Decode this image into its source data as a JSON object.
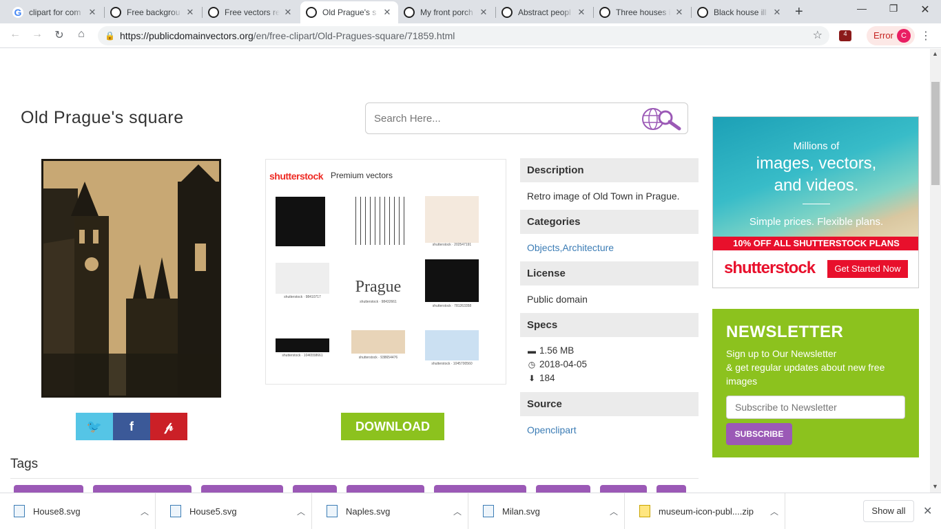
{
  "browser": {
    "tabs": [
      {
        "title": "clipart for com",
        "favicon": "google-icon"
      },
      {
        "title": "Free backgrou",
        "favicon": "site-icon"
      },
      {
        "title": "Free vectors re",
        "favicon": "site-icon"
      },
      {
        "title": "Old Prague's s",
        "favicon": "site-icon",
        "active": true
      },
      {
        "title": "My front porch",
        "favicon": "site-icon"
      },
      {
        "title": "Abstract peopl",
        "favicon": "site-icon"
      },
      {
        "title": "Three houses i",
        "favicon": "site-icon"
      },
      {
        "title": "Black house ill",
        "favicon": "site-icon"
      }
    ],
    "url_domain": "https://publicdomainvectors.org",
    "url_path": "/en/free-clipart/Old-Pragues-square/71859.html",
    "extension_badge": "4",
    "error_label": "Error",
    "avatar_letter": "C"
  },
  "page": {
    "title": "Old Prague's square",
    "search_placeholder": "Search Here...",
    "download_label": "DOWNLOAD",
    "ad": {
      "brand": "shutterstock",
      "subtitle": "Premium vectors",
      "captions": [
        "shutterstock · 202547191",
        "shutterstock · 98410717",
        "Prague",
        "shutterstock · 98432661",
        "shutterstock · 781263358",
        "shutterstock · 1046558661",
        "shutterstock · 938654476",
        "shutterstock · 1045700560"
      ]
    },
    "info": {
      "description_header": "Description",
      "description": "Retro image of Old Town in Prague.",
      "categories_header": "Categories",
      "categories": "Objects,Architecture",
      "license_header": "License",
      "license": "Public domain",
      "specs_header": "Specs",
      "size": "1.56 MB",
      "date": "2018-04-05",
      "downloads": "184",
      "source_header": "Source",
      "source": "Openclipart"
    },
    "tags_header": "Tags"
  },
  "side_ad": {
    "line1": "Millions of",
    "line2": "images, vectors,",
    "line3": "and videos.",
    "line4": "Simple prices. Flexible plans.",
    "banner": "10% OFF ALL SHUTTERSTOCK PLANS",
    "logo": "shutterstock",
    "cta": "Get Started Now"
  },
  "newsletter": {
    "title": "NEWSLETTER",
    "line1": "Sign up to Our Newsletter",
    "line2": "& get regular updates about new free images",
    "placeholder": "Subscribe to Newsletter",
    "button": "SUBSCRIBE"
  },
  "downloads": {
    "items": [
      "House8.svg",
      "House5.svg",
      "Naples.svg",
      "Milan.svg",
      "museum-icon-publ....zip"
    ],
    "show_all": "Show all"
  },
  "colors": {
    "accent_green": "#8cc21e",
    "accent_purple": "#9b59b6",
    "twitter": "#55c5e6",
    "facebook": "#3b5998",
    "pinterest": "#cb2027",
    "shutterstock_red": "#e8102c"
  }
}
